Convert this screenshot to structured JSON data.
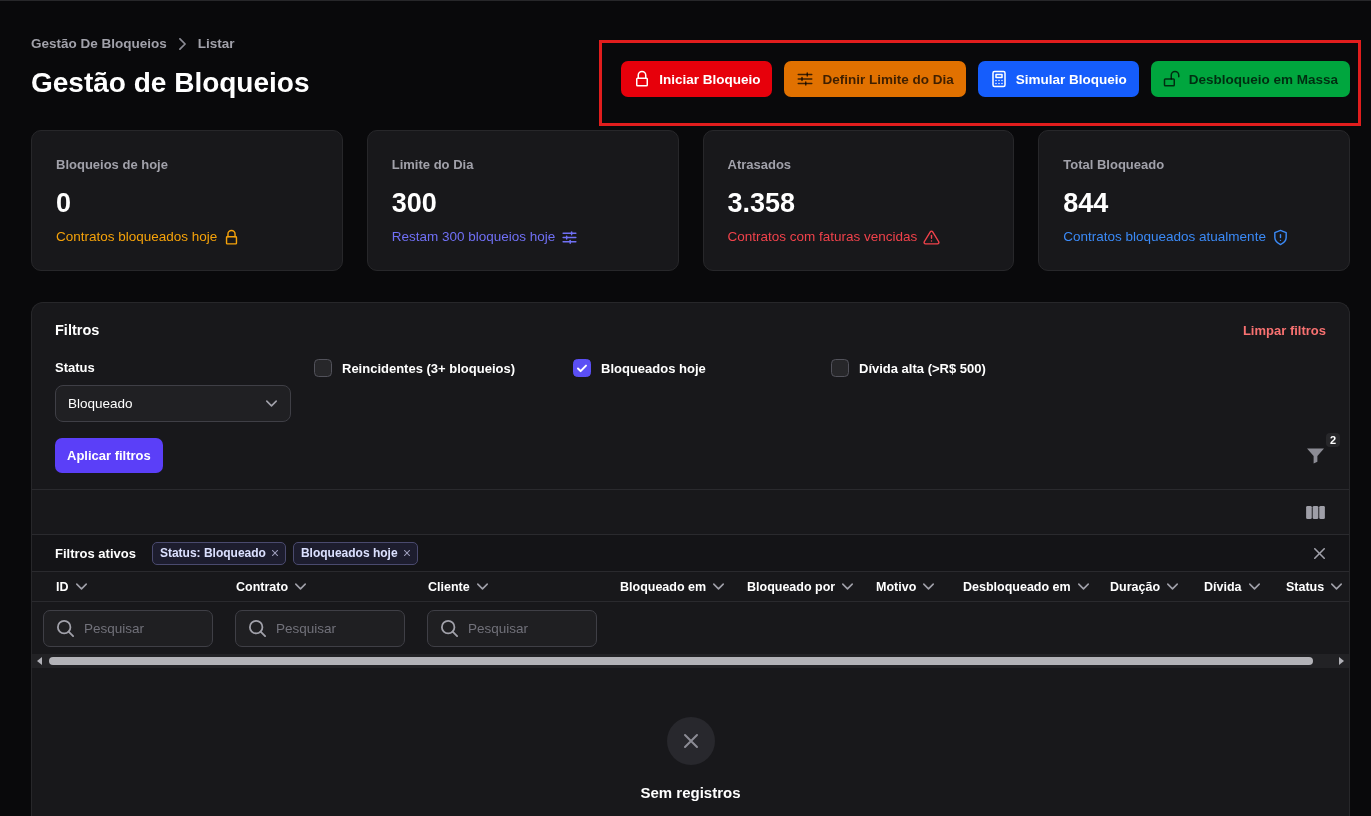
{
  "breadcrumbs": [
    {
      "label": "Gestão De Bloqueios"
    },
    {
      "label": "Listar"
    }
  ],
  "title": "Gestão de Bloqueios",
  "toolbar": {
    "highlighted": true,
    "buttons": [
      {
        "label": "Iniciar Bloqueio",
        "color": "#e7000b"
      },
      {
        "label": "Definir Limite do Dia",
        "color": "#e17100"
      },
      {
        "label": "Simular Bloqueio",
        "color": "#155dfc"
      },
      {
        "label": "Desbloqueio em Massa",
        "color": "#00a63e"
      }
    ]
  },
  "stats": [
    {
      "label": "Bloqueios de hoje",
      "value": "0",
      "caption": "Contratos bloqueados hoje",
      "color": "#f5a20a"
    },
    {
      "label": "Limite do Dia",
      "value": "300",
      "caption": "Restam 300 bloqueios hoje",
      "color": "#7070f5"
    },
    {
      "label": "Atrasados",
      "value": "3.358",
      "caption": "Contratos com faturas vencidas",
      "color": "#f0424b"
    },
    {
      "label": "Total Bloqueado",
      "value": "844",
      "caption": "Contratos bloqueados atualmente",
      "color": "#3b8af7"
    }
  ],
  "filters": {
    "title": "Filtros",
    "clear_label": "Limpar filtros",
    "status": {
      "label": "Status",
      "value": "Bloqueado"
    },
    "checkboxes": [
      {
        "label": "Reincidentes (3+ bloqueios)",
        "checked": false
      },
      {
        "label": "Bloqueados hoje",
        "checked": true
      },
      {
        "label": "Dívida alta (>R$ 500)",
        "checked": false
      }
    ],
    "apply_label": "Aplicar filtros",
    "active_count": "2"
  },
  "table": {
    "active_filters": {
      "label": "Filtros ativos",
      "chips": [
        {
          "label": "Status: Bloqueado"
        },
        {
          "label": "Bloqueados hoje"
        }
      ]
    },
    "columns": [
      {
        "label": "ID",
        "placeholder": "Pesquisar"
      },
      {
        "label": "Contrato",
        "placeholder": "Pesquisar"
      },
      {
        "label": "Cliente",
        "placeholder": "Pesquisar"
      },
      {
        "label": "Bloqueado em"
      },
      {
        "label": "Bloqueado por"
      },
      {
        "label": "Motivo"
      },
      {
        "label": "Desbloqueado em"
      },
      {
        "label": "Duração"
      },
      {
        "label": "Dívida"
      },
      {
        "label": "Status"
      }
    ],
    "empty_message": "Sem registros"
  }
}
